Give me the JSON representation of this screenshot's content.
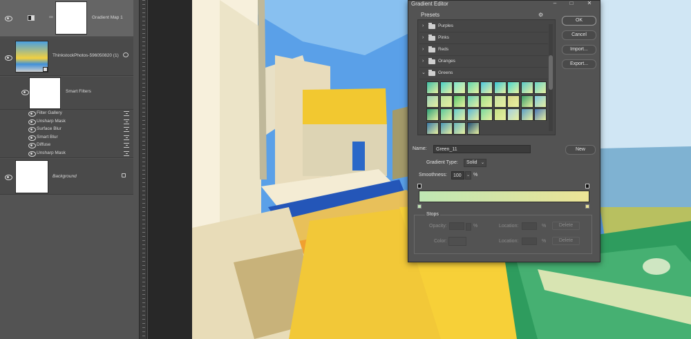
{
  "layers": [
    {
      "name": "Gradient Map 1",
      "type": "adjustment"
    },
    {
      "name": "ThinkstockPhotos-596050820 (1)",
      "type": "smart-object"
    },
    {
      "name": "Smart Filters",
      "type": "smart-filters"
    },
    {
      "name": "Background",
      "type": "background"
    }
  ],
  "smart_filters": [
    "Filter Gallery",
    "Unsharp Mask",
    "Surface Blur",
    "Smart Blur",
    "Diffuse",
    "Unsharp Mask"
  ],
  "dialog": {
    "title": "Gradient Editor",
    "presets_label": "Presets",
    "folders": [
      "Purples",
      "Pinks",
      "Reds",
      "Oranges",
      "Greens"
    ],
    "buttons": {
      "ok": "OK",
      "cancel": "Cancel",
      "import": "Import...",
      "export": "Export...",
      "new": "New"
    },
    "name_label": "Name:",
    "name_value": "Green_11",
    "gradient_type_label": "Gradient Type:",
    "gradient_type_value": "Solid",
    "smoothness_label": "Smoothness:",
    "smoothness_value": "100",
    "smoothness_unit": "%",
    "stops_label": "Stops",
    "opacity_label": "Opacity:",
    "color_label": "Color:",
    "location_label": "Location:",
    "percent": "%",
    "delete_label": "Delete",
    "gradient_start_color": "#bfe6b4",
    "gradient_end_color": "#ece496",
    "swatch_colors": [
      "#3fbfa8",
      "#48d0c8",
      "#7fe6d0",
      "#5fd6b0",
      "#4cc8e0",
      "#38c8d8",
      "#4ad8d0",
      "#58c8c8",
      "#6ad6c8",
      "#9ad0b8",
      "#b8e0a0",
      "#58c870",
      "#66d0b8",
      "#9ee08a",
      "#c6e0a0",
      "#d6d68a",
      "#3c9e6c",
      "#7ec8e0",
      "#2ea07a",
      "#5ac89e",
      "#66ccd0",
      "#5ab8d8",
      "#7ad8a0",
      "#c4e088",
      "#a6d0e0",
      "#5a9ec8",
      "#4a78b8",
      "#3a7aa8",
      "#4a96b8",
      "#6ab6c0",
      "#1e4e78"
    ]
  }
}
